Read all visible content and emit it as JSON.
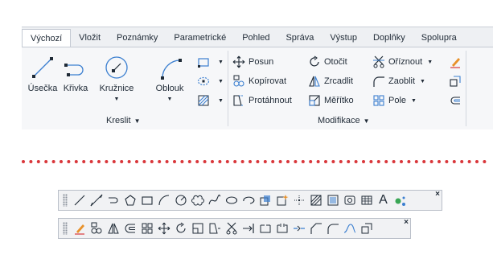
{
  "tabs": [
    "Výchozí",
    "Vložit",
    "Poznámky",
    "Parametrické",
    "Pohled",
    "Správa",
    "Výstup",
    "Doplňky",
    "Spolupra"
  ],
  "draw_panel": {
    "title": "Kreslit",
    "tools": [
      "Úsečka",
      "Křivka",
      "Kružnice",
      "Oblouk"
    ]
  },
  "modify_panel": {
    "title": "Modifikace",
    "col1": [
      "Posun",
      "Kopírovat",
      "Protáhnout"
    ],
    "col2": [
      "Otočit",
      "Zrcadlit",
      "Měřítko"
    ],
    "col3": [
      "Oříznout",
      "Zaoblit",
      "Pole"
    ]
  },
  "draw_toolbar": {
    "icons": [
      "line-icon",
      "construction-line-icon",
      "polyline-icon",
      "polygon-icon",
      "rectangle-icon",
      "arc-icon",
      "circle-icon",
      "revision-cloud-icon",
      "spline-icon",
      "ellipse-icon",
      "ellipse-arc-icon",
      "insert-block-icon",
      "make-block-icon",
      "point-icon",
      "hatch-icon",
      "gradient-icon",
      "region-icon",
      "table-icon",
      "multiline-text-icon",
      "add-selected-icon"
    ],
    "text_icon": "A",
    "close": "×"
  },
  "modify_toolbar": {
    "icons": [
      "erase-icon",
      "copy-icon",
      "mirror-icon",
      "offset-icon",
      "array-icon",
      "move-icon",
      "rotate-icon",
      "scale-icon",
      "stretch-icon",
      "trim-icon",
      "extend-icon",
      "break-at-point-icon",
      "break-icon",
      "join-icon",
      "chamfer-icon",
      "fillet-icon",
      "blend-curves-icon",
      "explode-icon"
    ],
    "close": "×"
  },
  "colors": {
    "accent": "#3b7fd0",
    "dots": "#d9373b",
    "orange": "#e8912a",
    "green": "#3aa655"
  }
}
